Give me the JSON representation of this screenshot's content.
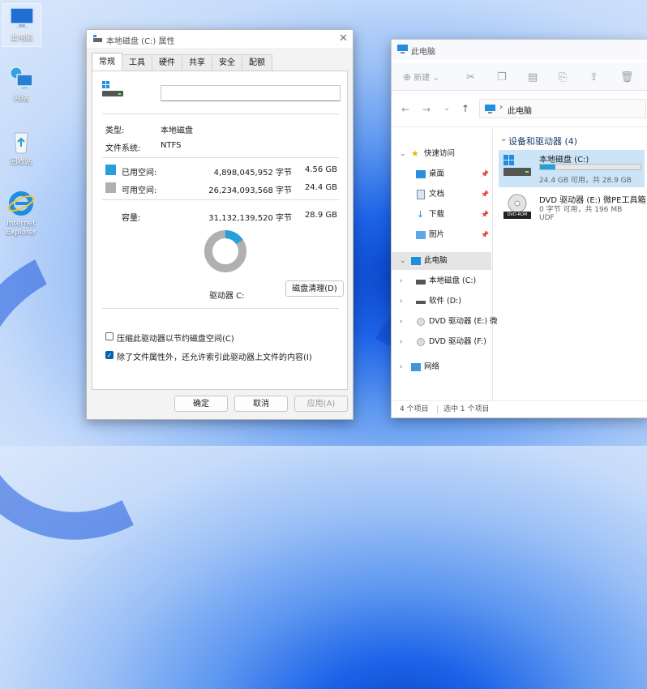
{
  "desktop": {
    "icons": [
      {
        "label": "此电脑"
      },
      {
        "label": "网络"
      },
      {
        "label": "回收站"
      },
      {
        "label": "Internet Explorer"
      }
    ]
  },
  "properties": {
    "title": "本地磁盘 (C:) 属性",
    "tabs": [
      "常规",
      "工具",
      "硬件",
      "共享",
      "安全",
      "配额"
    ],
    "active_tab": "常规",
    "name_value": "",
    "type_label": "类型:",
    "type_value": "本地磁盘",
    "fs_label": "文件系统:",
    "fs_value": "NTFS",
    "used_label": "已用空间:",
    "used_bytes": "4,898,045,952 字节",
    "used_gb": "4.56 GB",
    "free_label": "可用空间:",
    "free_bytes": "26,234,093,568 字节",
    "free_gb": "24.4 GB",
    "cap_label": "容量:",
    "cap_bytes": "31,132,139,520 字节",
    "cap_gb": "28.9 GB",
    "used_fraction": 0.157,
    "drive_label": "驱动器 C:",
    "cleanup_button": "磁盘清理(D)",
    "compress_label": "压缩此驱动器以节约磁盘空间(C)",
    "compress_checked": false,
    "index_label": "除了文件属性外，还允许索引此驱动器上文件的内容(I)",
    "index_checked": true,
    "ok_button": "确定",
    "cancel_button": "取消",
    "apply_button": "应用(A)",
    "colors": {
      "used": "#26a0da",
      "free": "#b0b0b0"
    }
  },
  "explorer": {
    "title": "此电脑",
    "new_label": "新建",
    "address_path": "此电脑",
    "nav": {
      "quick_access": "快速访问",
      "desktop": "桌面",
      "documents": "文档",
      "downloads": "下载",
      "pictures": "图片",
      "this_pc": "此电脑",
      "local_c": "本地磁盘 (C:)",
      "software_d": "软件 (D:)",
      "dvd_e": "DVD 驱动器 (E:) 微",
      "dvd_f": "DVD 驱动器 (F:)",
      "network": "网络"
    },
    "section_header": "设备和驱动器 (4)",
    "drives": [
      {
        "name": "本地磁盘 (C:)",
        "detail": "24.4 GB 可用，共 28.9 GB",
        "used_fraction": 0.157
      },
      {
        "name": "DVD 驱动器 (E:) 微PE工具箱",
        "detail": "0 字节 可用，共 196 MB",
        "detail2": "UDF",
        "badge": "DVD-ROM"
      }
    ],
    "status_items": "4 个项目",
    "status_selected": "选中 1 个项目"
  }
}
